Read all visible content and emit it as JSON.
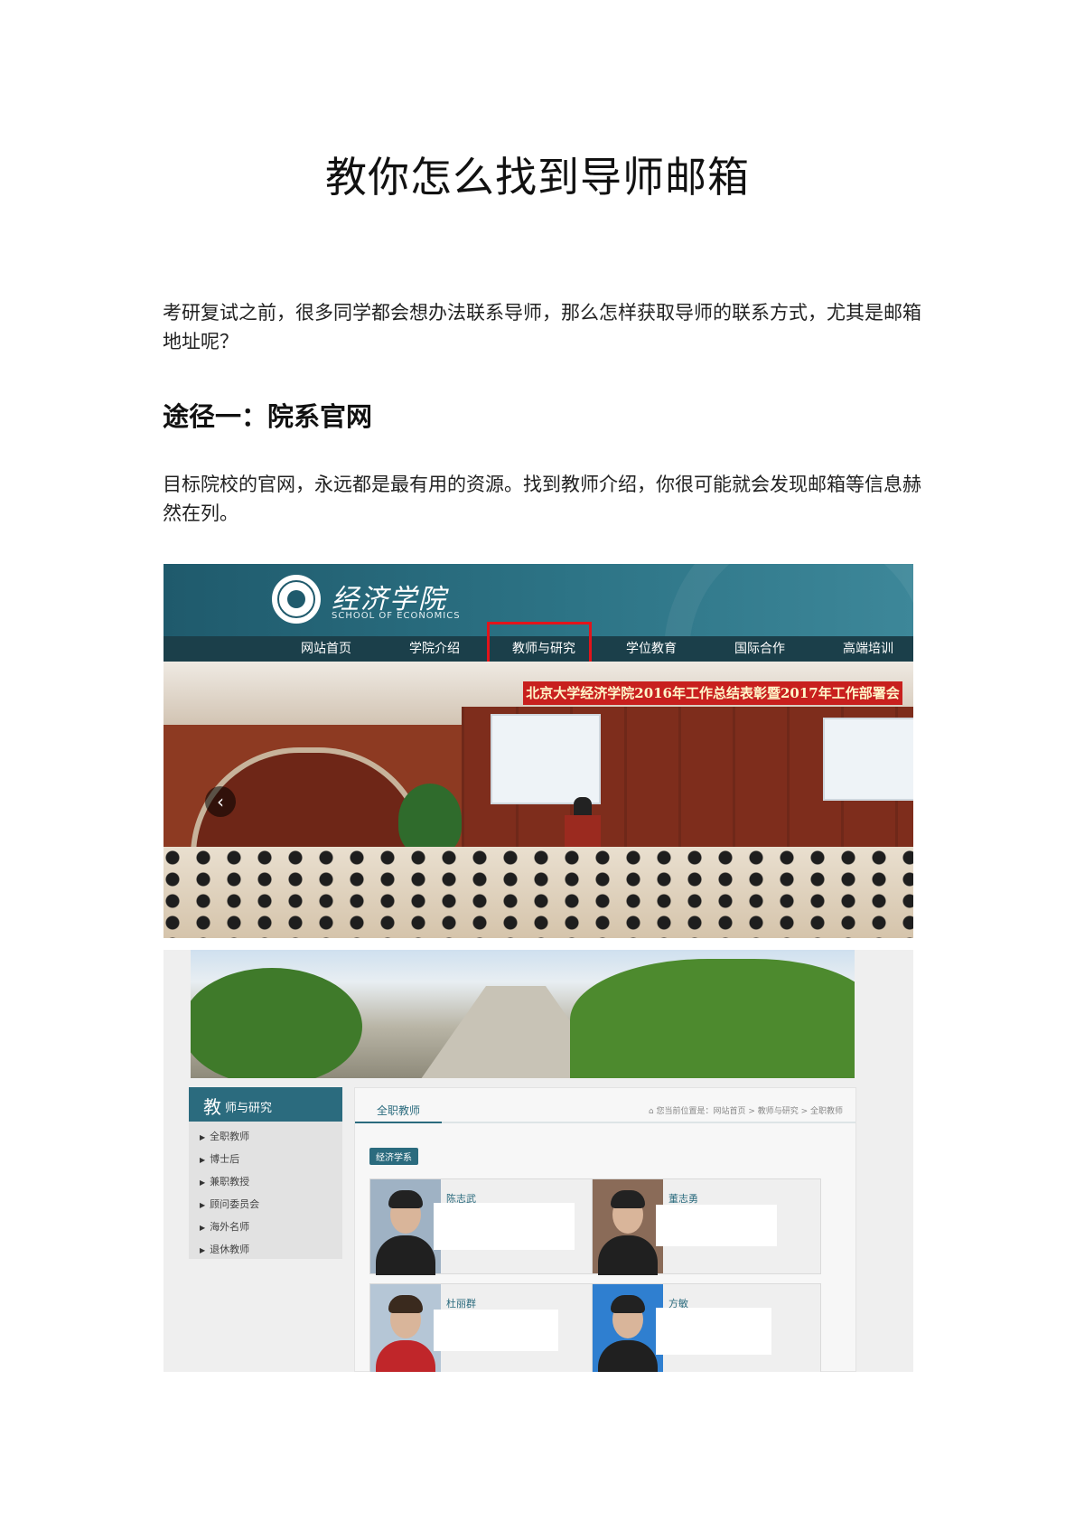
{
  "document": {
    "title": "教你怎么找到导师邮箱",
    "intro": "考研复试之前，很多同学都会想办法联系导师，那么怎样获取导师的联系方式，尤其是邮箱地址呢？",
    "section_heading": "途径一：院系官网",
    "section_text": "目标院校的官网，永远都是最有用的资源。找到教师介绍，你很可能就会发现邮箱等信息赫然在列。"
  },
  "site": {
    "logo_cn": "经济学院",
    "logo_en": "SCHOOL OF ECONOMICS",
    "nav": [
      "网站首页",
      "学院介绍",
      "教师与研究",
      "学位教育",
      "国际合作",
      "高端培训"
    ],
    "highlighted_nav": "教师与研究",
    "banner": "北京大学经济学院2016年工作总结表彰暨2017年工作部署会",
    "slider_prev": "‹",
    "highlight_color": "#e2141b",
    "brand_color": "#2b6b7e"
  },
  "faculty_page": {
    "sidebar_big": "教",
    "sidebar_title": "师与研究",
    "sidebar_items": [
      "全职教师",
      "博士后",
      "兼职教授",
      "顾问委员会",
      "海外名师",
      "退休教师"
    ],
    "tab": "全职教师",
    "breadcrumb": "⌂ 您当前位置是：网站首页 > 教师与研究 > 全职教师",
    "dept_tag": "经济学系",
    "cards": [
      {
        "name": "陈志武"
      },
      {
        "name": "董志勇"
      },
      {
        "name": "杜丽群"
      },
      {
        "name": "方敏"
      }
    ]
  }
}
